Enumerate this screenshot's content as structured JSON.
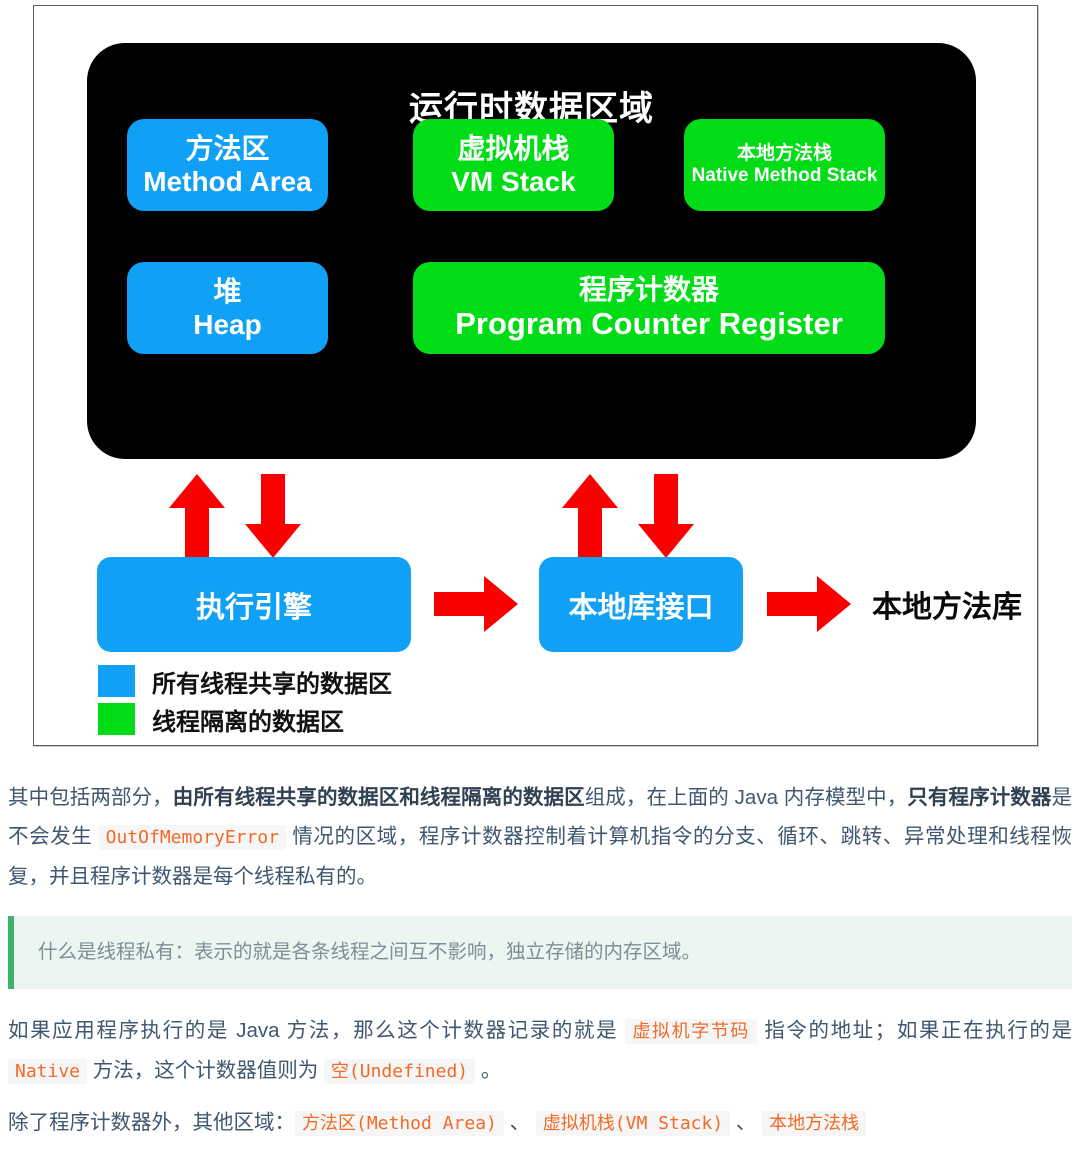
{
  "figure": {
    "panel_title": "运行时数据区域",
    "memory_boxes": [
      {
        "cn": "方法区",
        "en": "Method Area",
        "color": "#10a0f5"
      },
      {
        "cn": "虚拟机栈",
        "en": "VM Stack",
        "color": "#00dd17"
      },
      {
        "cn": "本地方法栈",
        "en": "Native Method Stack",
        "color": "#00dd17"
      },
      {
        "cn": "堆",
        "en": "Heap",
        "color": "#10a0f5"
      },
      {
        "cn": "程序计数器",
        "en": "Program Counter Register",
        "color": "#00dd17"
      }
    ],
    "bottom_boxes": [
      {
        "label": "执行引擎",
        "color": "#10a0f5"
      },
      {
        "label": "本地库接口",
        "color": "#10a0f5"
      }
    ],
    "plain_label": "本地方法库",
    "legend": [
      {
        "swatch": "#10a0f5",
        "label": "所有线程共享的数据区"
      },
      {
        "swatch": "#00dd17",
        "label": "线程隔离的数据区"
      }
    ],
    "arrow_color": "#fa0000"
  },
  "article": {
    "p1": {
      "t1": "其中包括两部分，",
      "b1": "由所有线程共享的数据区和线程隔离的数据区",
      "t2": "组成，在上面的 Java 内存模型中，",
      "b2": "只有程序计数器",
      "t3": "是不会发生 ",
      "c1": "OutOfMemoryError",
      "t4": " 情况的区域，程序计数器控制着计算机指令的分支、循环、跳转、异常处理和线程恢复，并且程序计数器是每个线程私有的。"
    },
    "quote": "什么是线程私有：表示的就是各条线程之间互不影响，独立存储的内存区域。",
    "p2": {
      "t1": "如果应用程序执行的是 Java 方法，那么这个计数器记录的就是 ",
      "c1": "虚拟机字节码",
      "t2": " 指令的地址；如果正在执行的是 ",
      "c2": "Native",
      "t3": " 方法，这个计数器值则为 ",
      "c3": "空(Undefined)",
      "t4": " 。"
    },
    "p3": {
      "t1": "除了程序计数器外，其他区域：",
      "c1": "方法区(Method Area)",
      "t2": " 、 ",
      "c2": "虚拟机栈(VM Stack)",
      "t3": " 、 ",
      "c3": "本地方法栈"
    }
  }
}
